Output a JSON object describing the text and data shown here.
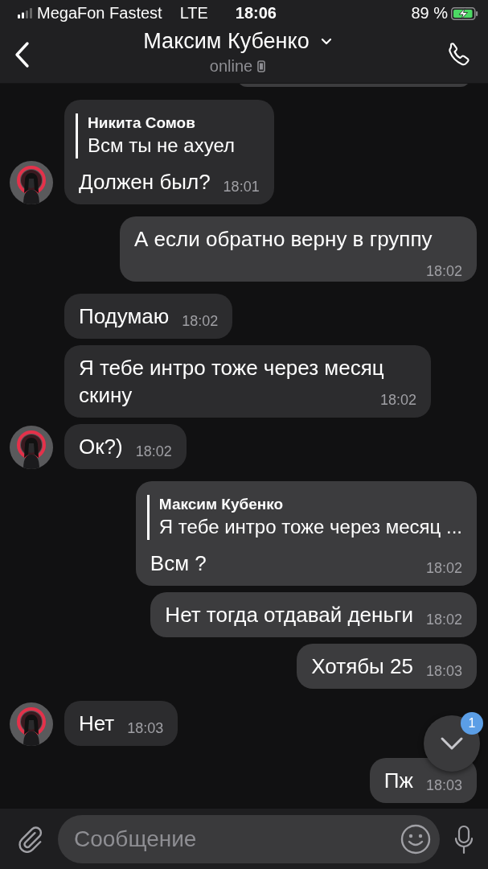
{
  "status_bar": {
    "carrier": "MegaFon Fastest",
    "network": "LTE",
    "time": "18:06",
    "battery": "89 %"
  },
  "header": {
    "title": "Максим Кубенко",
    "status": "online"
  },
  "messages": [
    {
      "kind": "incoming",
      "avatar": true,
      "reply": {
        "author": "Никита Сомов",
        "text": "Всм ты не ахуел"
      },
      "text": "Должен был?",
      "time": "18:01"
    },
    {
      "kind": "outgoing",
      "text": "А если обратно верну в группу",
      "time": "18:02"
    },
    {
      "kind": "incoming",
      "avatar": false,
      "text": "Подумаю",
      "time": "18:02"
    },
    {
      "kind": "incoming",
      "avatar": false,
      "text": "Я тебе интро тоже через месяц скину",
      "time": "18:02"
    },
    {
      "kind": "incoming",
      "avatar": true,
      "text": "Ок?)",
      "time": "18:02"
    },
    {
      "kind": "outgoing",
      "reply": {
        "author": "Максим Кубенко",
        "text": "Я тебе интро тоже через месяц ..."
      },
      "text": "Всм ?",
      "time": "18:02"
    },
    {
      "kind": "outgoing",
      "text": "Нет тогда отдавай деньги",
      "time": "18:02"
    },
    {
      "kind": "outgoing",
      "text": "Хотябы 25",
      "time": "18:03"
    },
    {
      "kind": "incoming",
      "avatar": true,
      "text": "Нет",
      "time": "18:03"
    },
    {
      "kind": "outgoing",
      "text": "Пж",
      "time": "18:03"
    }
  ],
  "scroll_button": {
    "badge": "1"
  },
  "composer": {
    "placeholder": "Сообщение"
  }
}
